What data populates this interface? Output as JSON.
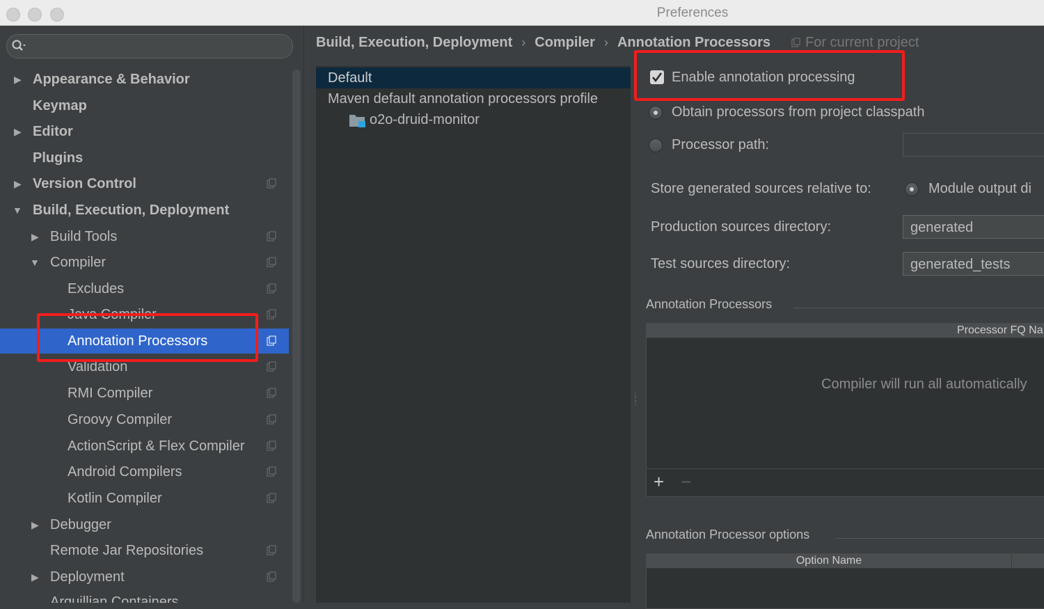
{
  "window": {
    "title": "Preferences"
  },
  "sidebar": {
    "search_placeholder": "",
    "items": [
      {
        "label": "Appearance & Behavior"
      },
      {
        "label": "Keymap"
      },
      {
        "label": "Editor"
      },
      {
        "label": "Plugins"
      },
      {
        "label": "Version Control"
      },
      {
        "label": "Build, Execution, Deployment"
      },
      {
        "label": "Build Tools"
      },
      {
        "label": "Compiler"
      },
      {
        "label": "Excludes"
      },
      {
        "label": "Java Compiler"
      },
      {
        "label": "Annotation Processors"
      },
      {
        "label": "Validation"
      },
      {
        "label": "RMI Compiler"
      },
      {
        "label": "Groovy Compiler"
      },
      {
        "label": "ActionScript & Flex Compiler"
      },
      {
        "label": "Android Compilers"
      },
      {
        "label": "Kotlin Compiler"
      },
      {
        "label": "Debugger"
      },
      {
        "label": "Remote Jar Repositories"
      },
      {
        "label": "Deployment"
      },
      {
        "label": "Arquillian Containers"
      }
    ]
  },
  "breadcrumb": {
    "items": [
      "Build, Execution, Deployment",
      "Compiler",
      "Annotation Processors"
    ],
    "separator": "›",
    "scope": "For current project"
  },
  "profiles": {
    "items": [
      "Default",
      "Maven default annotation processors profile",
      "o2o-druid-monitor"
    ]
  },
  "settings": {
    "enable_label": "Enable annotation processing",
    "enable_checked": true,
    "obtain_label": "Obtain processors from project classpath",
    "processor_path_label": "Processor path:",
    "processor_path_value": "",
    "store_label": "Store generated sources relative to:",
    "store_option": "Module output di",
    "production_label": "Production sources directory:",
    "production_value": "generated",
    "test_label": "Test sources directory:",
    "test_value": "generated_tests"
  },
  "processors_section": {
    "title": "Annotation Processors",
    "column": "Processor FQ Na",
    "empty_text": "Compiler will run all automatically",
    "add": "+",
    "remove": "−"
  },
  "options_section": {
    "title": "Annotation Processor options",
    "column": "Option Name"
  },
  "colors": {
    "selection": "#2f65ca",
    "highlight_box": "#f21d1d",
    "background": "#3c3f41"
  }
}
